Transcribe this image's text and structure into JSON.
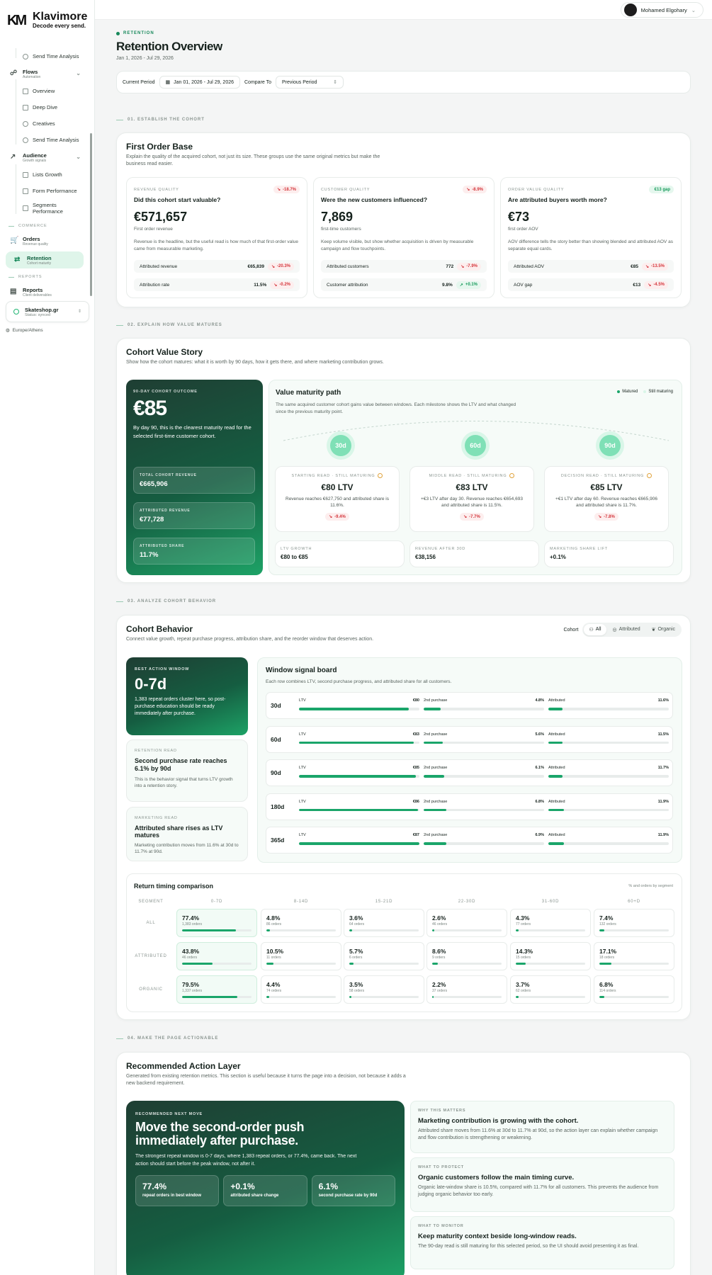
{
  "brand": {
    "name": "Klavimore",
    "tagline": "Decode every send.",
    "mark": "KM"
  },
  "user": {
    "name": "Mohamed Elgohary"
  },
  "sidebar": {
    "top_item": "Send Time Analysis",
    "flows": {
      "label": "Flows",
      "sub": "Automation",
      "items": [
        "Overview",
        "Deep Dive",
        "Creatives",
        "Send Time Analysis"
      ]
    },
    "audience": {
      "label": "Audience",
      "sub": "Growth signals",
      "items": [
        "Lists Growth",
        "Form Performance",
        "Segments Performance"
      ]
    },
    "commerce_label": "COMMERCE",
    "orders": {
      "label": "Orders",
      "sub": "Revenue quality"
    },
    "retention": {
      "label": "Retention",
      "sub": "Cohort maturity"
    },
    "reports_label": "REPORTS",
    "reports": {
      "label": "Reports",
      "sub": "Client deliverables"
    },
    "store": {
      "name": "Skateshop.gr",
      "status": "Status: synced"
    },
    "timezone": "Europe/Athens"
  },
  "header": {
    "crumb": "RETENTION",
    "title": "Retention Overview",
    "date_range": "Jan 1, 2026 - Jul 29, 2026"
  },
  "filters": {
    "current_label": "Current Period",
    "current_value": "Jan 01, 2026 - Jul 29, 2026",
    "compare_label": "Compare To",
    "compare_value": "Previous Period"
  },
  "sections": {
    "s1": "01. ESTABLISH THE COHORT",
    "s2": "02. EXPLAIN HOW VALUE MATURES",
    "s3": "03. ANALYZE COHORT BEHAVIOR",
    "s4": "04. MAKE THE PAGE ACTIONABLE"
  },
  "first_order": {
    "title": "First Order Base",
    "desc": "Explain the quality of the acquired cohort, not just its size. These groups use the same original metrics but make the business read easier.",
    "cards": [
      {
        "eyebrow": "REVENUE QUALITY",
        "delta": "-18.7%",
        "dir": "neg",
        "question": "Did this cohort start valuable?",
        "value": "€571,657",
        "caption": "First order revenue",
        "text": "Revenue is the headline, but the useful read is how much of that first-order value came from measurable marketing.",
        "rows": [
          {
            "label": "Attributed revenue",
            "value": "€65,839",
            "delta": "-20.3%",
            "dir": "neg"
          },
          {
            "label": "Attribution rate",
            "value": "11.5%",
            "delta": "-0.2%",
            "dir": "neg"
          }
        ]
      },
      {
        "eyebrow": "CUSTOMER QUALITY",
        "delta": "-8.9%",
        "dir": "neg",
        "question": "Were the new customers influenced?",
        "value": "7,869",
        "caption": "first-time customers",
        "text": "Keep volume visible, but show whether acquisition is driven by measurable campaign and flow touchpoints.",
        "rows": [
          {
            "label": "Attributed customers",
            "value": "772",
            "delta": "-7.9%",
            "dir": "neg"
          },
          {
            "label": "Customer attribution",
            "value": "9.8%",
            "delta": "+0.1%",
            "dir": "pos"
          }
        ]
      },
      {
        "eyebrow": "ORDER VALUE QUALITY",
        "delta": "€13 gap",
        "dir": "pos",
        "question": "Are attributed buyers worth more?",
        "value": "€73",
        "caption": "first order AOV",
        "text": "AOV difference tells the story better than showing blended and attributed AOV as separate equal cards.",
        "rows": [
          {
            "label": "Attributed AOV",
            "value": "€85",
            "delta": "-13.5%",
            "dir": "neg"
          },
          {
            "label": "AOV gap",
            "value": "€13",
            "delta": "-4.5%",
            "dir": "neg"
          }
        ]
      }
    ]
  },
  "value_story": {
    "title": "Cohort Value Story",
    "desc": "Show how the cohort matures: what it is worth by 90 days, how it gets there, and where marketing contribution grows.",
    "outcome": {
      "eyebrow": "90-DAY COHORT OUTCOME",
      "value": "€85",
      "text": "By day 90, this is the clearest maturity read for the selected first-time customer cohort.",
      "stats": [
        {
          "label": "TOTAL COHORT REVENUE",
          "value": "€665,906"
        },
        {
          "label": "ATTRIBUTED REVENUE",
          "value": "€77,728"
        },
        {
          "label": "ATTRIBUTED SHARE",
          "value": "11.7%"
        }
      ]
    },
    "path": {
      "title": "Value maturity path",
      "legend": [
        "Matured",
        "Still maturing"
      ],
      "desc": "The same acquired customer cohort gains value between windows. Each milestone shows the LTV and what changed since the previous maturity point.",
      "milestones": [
        {
          "day": "30d",
          "eyebrow": "STARTING READ · STILL MATURING",
          "ltv": "€80 LTV",
          "text": "Revenue reaches €627,750 and attributed share is 11.6%.",
          "delta": "-9.4%"
        },
        {
          "day": "60d",
          "eyebrow": "MIDDLE READ · STILL MATURING",
          "ltv": "€83 LTV",
          "text": "+€3 LTV after day 30. Revenue reaches €654,693 and attributed share is 11.5%.",
          "delta": "-7.7%"
        },
        {
          "day": "90d",
          "eyebrow": "DECISION READ · STILL MATURING",
          "ltv": "€85 LTV",
          "text": "+€1 LTV after day 60. Revenue reaches €665,906 and attributed share is 11.7%.",
          "delta": "-7.8%"
        }
      ],
      "summary": [
        {
          "label": "LTV GROWTH",
          "value": "€80 to €85"
        },
        {
          "label": "REVENUE AFTER 30D",
          "value": "€38,156"
        },
        {
          "label": "MARKETING SHARE LIFT",
          "value": "+0.1%"
        }
      ]
    }
  },
  "behavior": {
    "title": "Cohort Behavior",
    "desc": "Connect value growth, repeat purchase progress, attribution share, and the reorder window that deserves action.",
    "cohort_label": "Cohort",
    "tabs": [
      "All",
      "Attributed",
      "Organic"
    ],
    "best": {
      "eyebrow": "BEST ACTION WINDOW",
      "value": "0-7d",
      "text": "1,383 repeat orders cluster here, so post-purchase education should be ready immediately after purchase."
    },
    "retention_read": {
      "eyebrow": "RETENTION READ",
      "title": "Second purchase rate reaches 6.1% by 90d",
      "text": "This is the behavior signal that turns LTV growth into a retention story."
    },
    "marketing_read": {
      "eyebrow": "MARKETING READ",
      "title": "Attributed share rises as LTV matures",
      "text": "Marketing contribution moves from 11.6% at 30d to 11.7% at 90d."
    },
    "board": {
      "title": "Window signal board",
      "desc": "Each row combines LTV, second purchase progress, and attributed share for all customers.",
      "col_labels": [
        "LTV",
        "2nd purchase",
        "Attributed"
      ],
      "rows": [
        {
          "window": "30d",
          "ltv": "€80",
          "ltv_pct": 91,
          "second": "4.8%",
          "second_pct": 14,
          "attr": "11.6%",
          "attr_pct": 12
        },
        {
          "window": "60d",
          "ltv": "€83",
          "ltv_pct": 95,
          "second": "5.6%",
          "second_pct": 16,
          "attr": "11.5%",
          "attr_pct": 12
        },
        {
          "window": "90d",
          "ltv": "€85",
          "ltv_pct": 97,
          "second": "6.1%",
          "second_pct": 17,
          "attr": "11.7%",
          "attr_pct": 12
        },
        {
          "window": "180d",
          "ltv": "€86",
          "ltv_pct": 99,
          "second": "6.8%",
          "second_pct": 19,
          "attr": "11.9%",
          "attr_pct": 13
        },
        {
          "window": "365d",
          "ltv": "€87",
          "ltv_pct": 100,
          "second": "6.9%",
          "second_pct": 19,
          "attr": "11.9%",
          "attr_pct": 13
        }
      ]
    },
    "timing": {
      "title": "Return timing comparison",
      "note": "% and orders by segment",
      "headers": [
        "SEGMENT",
        "0-7D",
        "8-14D",
        "15-21D",
        "22-30D",
        "31-60D",
        "60+D"
      ],
      "rows": [
        {
          "segment": "ALL",
          "cells": [
            {
              "v": "77.4%",
              "o": "1,383 orders",
              "p": 77.4
            },
            {
              "v": "4.8%",
              "o": "86 orders",
              "p": 4.8
            },
            {
              "v": "3.6%",
              "o": "64 orders",
              "p": 3.6
            },
            {
              "v": "2.6%",
              "o": "46 orders",
              "p": 2.6
            },
            {
              "v": "4.3%",
              "o": "77 orders",
              "p": 4.3
            },
            {
              "v": "7.4%",
              "o": "132 orders",
              "p": 7.4
            }
          ]
        },
        {
          "segment": "ATTRIBUTED",
          "cells": [
            {
              "v": "43.8%",
              "o": "46 orders",
              "p": 43.8
            },
            {
              "v": "10.5%",
              "o": "11 orders",
              "p": 10.5
            },
            {
              "v": "5.7%",
              "o": "6 orders",
              "p": 5.7
            },
            {
              "v": "8.6%",
              "o": "9 orders",
              "p": 8.6
            },
            {
              "v": "14.3%",
              "o": "15 orders",
              "p": 14.3
            },
            {
              "v": "17.1%",
              "o": "18 orders",
              "p": 17.1
            }
          ]
        },
        {
          "segment": "ORGANIC",
          "cells": [
            {
              "v": "79.5%",
              "o": "1,337 orders",
              "p": 79.5
            },
            {
              "v": "4.4%",
              "o": "74 orders",
              "p": 4.4
            },
            {
              "v": "3.5%",
              "o": "58 orders",
              "p": 3.5
            },
            {
              "v": "2.2%",
              "o": "37 orders",
              "p": 2.2
            },
            {
              "v": "3.7%",
              "o": "62 orders",
              "p": 3.7
            },
            {
              "v": "6.8%",
              "o": "114 orders",
              "p": 6.8
            }
          ]
        }
      ]
    }
  },
  "actions": {
    "title": "Recommended Action Layer",
    "desc": "Generated from existing retention metrics. This section is useful because it turns the page into a decision, not because it adds a new backend requirement.",
    "next": {
      "eyebrow": "RECOMMENDED NEXT MOVE",
      "title": "Move the second-order push immediately after purchase.",
      "text": "The strongest repeat window is 0-7 days, where 1,383 repeat orders, or 77.4%, came back. The next action should start before the peak window, not after it.",
      "stats": [
        {
          "value": "77.4%",
          "label": "repeat orders in best window"
        },
        {
          "value": "+0.1%",
          "label": "attributed share change"
        },
        {
          "value": "6.1%",
          "label": "second purchase rate by 90d"
        }
      ]
    },
    "insights": [
      {
        "eyebrow": "WHY THIS MATTERS",
        "title": "Marketing contribution is growing with the cohort.",
        "text": "Attributed share moves from 11.6% at 30d to 11.7% at 90d, so the action layer can explain whether campaign and flow contribution is strengthening or weakening."
      },
      {
        "eyebrow": "WHAT TO PROTECT",
        "title": "Organic customers follow the main timing curve.",
        "text": "Organic late-window share is 10.5%, compared with 11.7% for all customers. This prevents the audience from judging organic behavior too early."
      },
      {
        "eyebrow": "WHAT TO MONITOR",
        "title": "Keep maturity context beside long-window reads.",
        "text": "The 90-day read is still maturing for this selected period, so the UI should avoid presenting it as final."
      }
    ]
  }
}
